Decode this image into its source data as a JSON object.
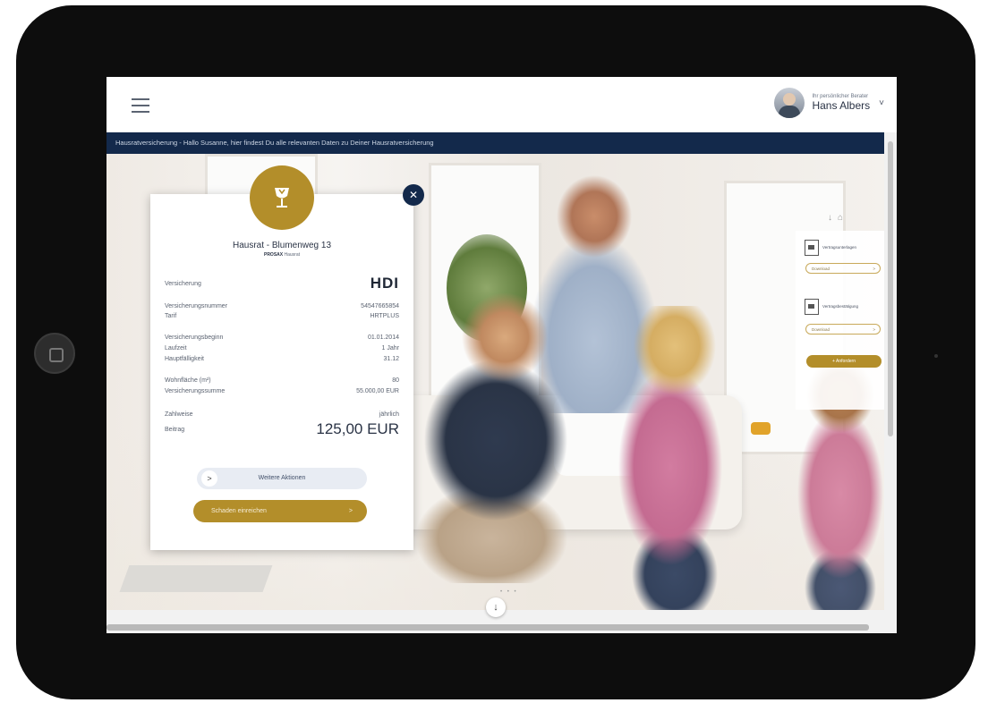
{
  "header": {
    "menu_icon": "hamburger-menu-icon",
    "advisor_caption": "Ihr persönlicher Berater",
    "advisor_name": "Hans Albers",
    "advisor_chevron": "˅"
  },
  "subheader": {
    "text": "Hausratversicherung - Hallo Susanne, hier findest Du alle relevanten Daten zu Deiner Hausratversicherung"
  },
  "card": {
    "icon": "wine-glass-icon",
    "title": "Hausrat - Blumenweg 13",
    "subtitle_strong": "PROSAX",
    "subtitle_rest": "Hausrat",
    "close": "✕",
    "rows": [
      {
        "label": "Versicherung",
        "value": "HDI"
      },
      {
        "label": "Versicherungsnummer",
        "value": "54547665854"
      },
      {
        "label": "Tarif",
        "value": "HRTPLUS"
      },
      {
        "label": "Versicherungsbeginn",
        "value": "01.01.2014"
      },
      {
        "label": "Laufzeit",
        "value": "1 Jahr"
      },
      {
        "label": "Hauptfälligkeit",
        "value": "31.12"
      },
      {
        "label": "Wohnfläche (m²)",
        "value": "80"
      },
      {
        "label": "Versicherungssumme",
        "value": "55.000,00 EUR"
      },
      {
        "label": "Zahlweise",
        "value": "jährlich"
      },
      {
        "label": "Beitrag",
        "value": "125,00 EUR"
      }
    ],
    "more_actions": "Weitere Aktionen",
    "more_arrow": ">",
    "claim_button": "Schaden einreichen",
    "claim_arrow": ">"
  },
  "side_panel": {
    "items": [
      {
        "label": "Vertragsunterlagen",
        "button": "Download"
      },
      {
        "label": "Vertragsbestätigung",
        "button": "Download"
      }
    ],
    "button_arrow": ">",
    "more": "+ Anfordern"
  },
  "footer": {
    "down_arrow": "↓",
    "pager_dots": "• • •"
  },
  "colors": {
    "navy": "#13294b",
    "gold": "#b38e2a",
    "bezel": "#0d0d0d"
  }
}
